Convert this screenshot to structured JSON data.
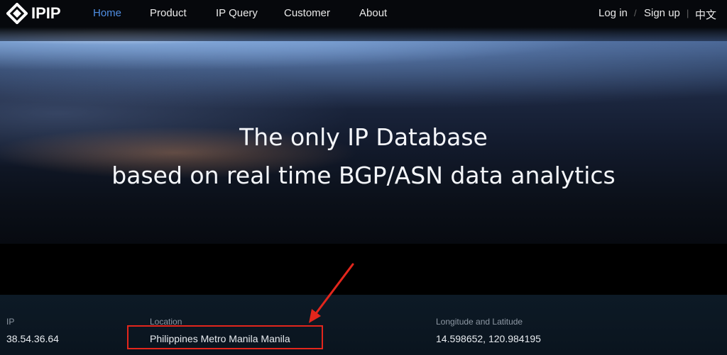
{
  "header": {
    "brand": "IPIP",
    "nav": [
      {
        "label": "Home",
        "active": true
      },
      {
        "label": "Product",
        "active": false
      },
      {
        "label": "IP Query",
        "active": false
      },
      {
        "label": "Customer",
        "active": false
      },
      {
        "label": "About",
        "active": false
      }
    ],
    "login": "Log in",
    "separator": "/",
    "signup": "Sign up",
    "lang_separator": "|",
    "language": "中文"
  },
  "hero": {
    "line1": "The only IP Database",
    "line2": "based on real time BGP/ASN data analytics"
  },
  "result": {
    "ip_label": "IP",
    "ip_value": "38.54.36.64",
    "location_label": "Location",
    "location_value": "Philippines Metro Manila Manila",
    "coords_label": "Longitude and Latitude",
    "coords_value": "14.598652, 120.984195"
  },
  "colors": {
    "active_nav": "#4f8ee3",
    "annotation": "#e3261c"
  },
  "icons": {
    "logo": "ipip-diamond-logo-icon",
    "annotation_arrow": "red-arrow-icon"
  }
}
